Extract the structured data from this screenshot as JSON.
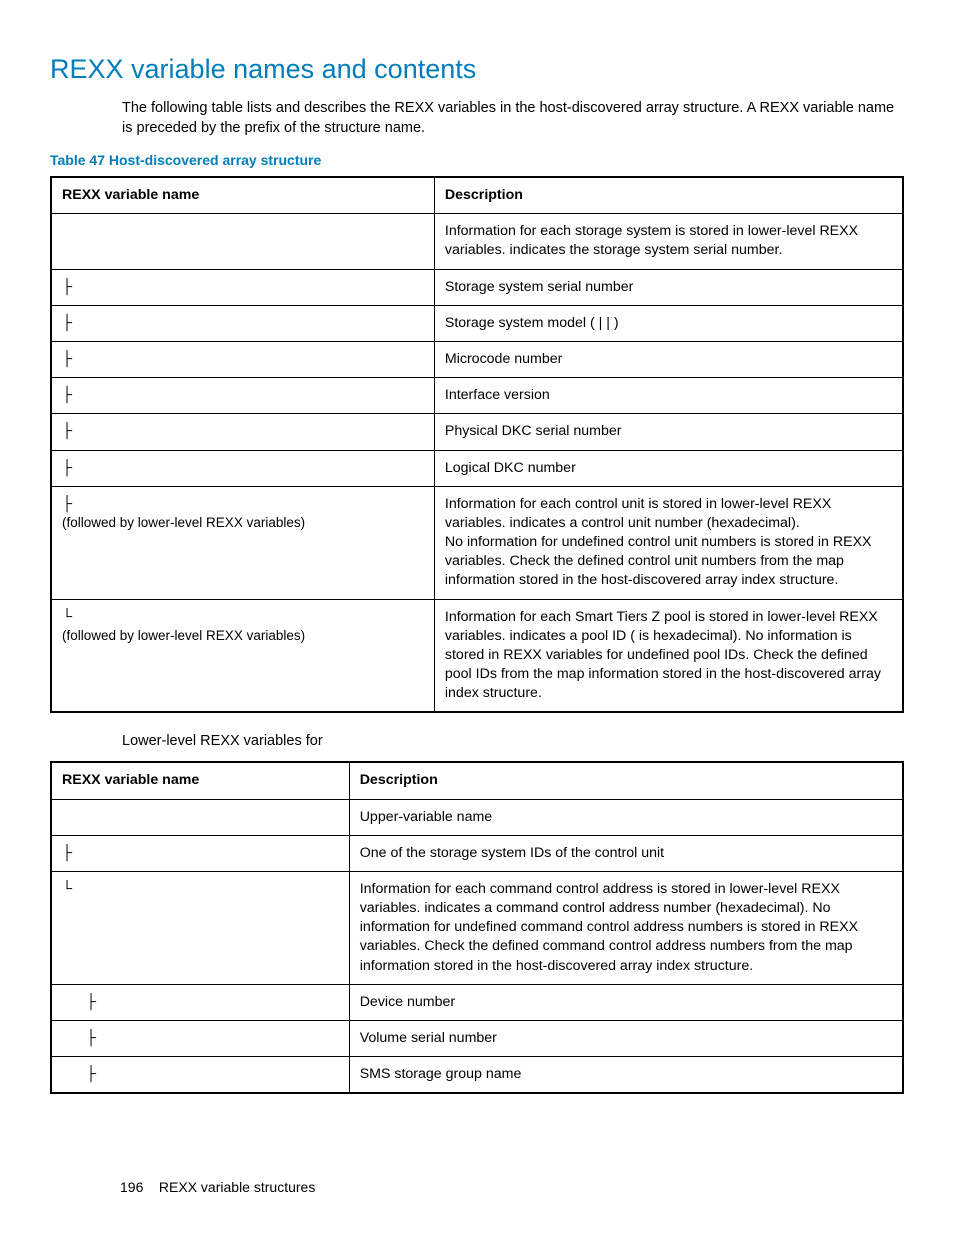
{
  "title": "REXX variable names and contents",
  "intro": "The following table lists and describes the REXX variables in the host-discovered array structure. A REXX variable name is preceded by the prefix of the structure name.",
  "caption1": "Table 47 Host-discovered array structure",
  "headers": {
    "col1": "REXX variable name",
    "col2": "Description"
  },
  "t1": [
    {
      "name": "",
      "desc": "Information for each storage system is stored in lower-level REXX variables.              indicates the storage system serial number."
    },
    {
      "name": "├",
      "desc": "Storage system serial number"
    },
    {
      "name": "├",
      "desc": "Storage system model (        |        |        )"
    },
    {
      "name": "├",
      "desc": "Microcode number"
    },
    {
      "name": "├",
      "desc": "Interface version"
    },
    {
      "name": "├",
      "desc": "Physical DKC serial number"
    },
    {
      "name": "├",
      "desc": "Logical DKC number"
    },
    {
      "name": "├",
      "sub": "(followed by lower-level REXX variables)",
      "desc": "Information for each control unit is stored in lower-level REXX variables.       indicates a control unit number (hexadecimal).\nNo information for undefined control unit numbers is stored in REXX variables. Check the defined control unit numbers from the map information stored in the host-discovered array index structure."
    },
    {
      "name": "└",
      "sub": "(followed by lower-level REXX variables)",
      "desc": "Information for each Smart Tiers Z pool is stored in lower-level REXX variables.        indicates a pool ID (      is hexadecimal). No information is stored in REXX variables for undefined pool IDs. Check the defined pool IDs from the map information stored in the host-discovered array index structure."
    }
  ],
  "subhead": "Lower-level REXX variables for",
  "t2": [
    {
      "name": "",
      "desc": "Upper-variable name"
    },
    {
      "name": "├",
      "desc": "One of the storage system IDs of the control unit"
    },
    {
      "name": "└",
      "desc": "Information for each command control address is stored in lower-level REXX variables.       indicates a command control address number (hexadecimal). No information for undefined command control address numbers is stored in REXX variables. Check the defined command control address numbers from the map information stored in the host-discovered array index structure."
    },
    {
      "name": "  ├",
      "indent": 24,
      "desc": "Device number"
    },
    {
      "name": "  ├",
      "indent": 24,
      "desc": "Volume serial number"
    },
    {
      "name": "  ├",
      "indent": 24,
      "desc": "SMS storage group name"
    }
  ],
  "footer_page": "196",
  "footer_text": "REXX variable structures"
}
